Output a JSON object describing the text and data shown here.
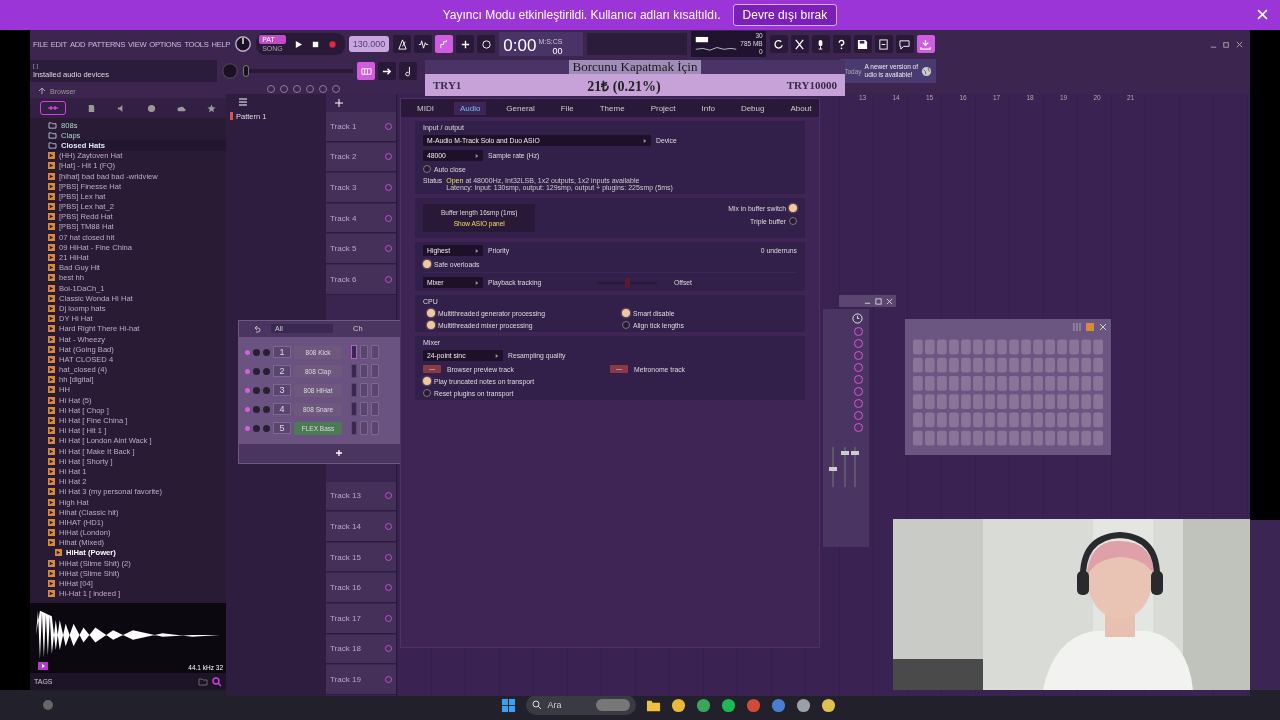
{
  "banner": {
    "message": "Yayıncı Modu etkinleştirildi. Kullanıcı adları kısaltıldı.",
    "button": "Devre dışı bırak"
  },
  "menu": [
    "FILE",
    "EDIT",
    "ADD",
    "PATTERNS",
    "VIEW",
    "OPTIONS",
    "TOOLS",
    "HELP"
  ],
  "transport": {
    "modes": [
      {
        "label": "PAT",
        "selected": true
      },
      {
        "label": "SONG",
        "selected": false
      }
    ],
    "tempo": "130.000",
    "time": "0:00",
    "time_cs": "00",
    "time_unit": "M:S:CS"
  },
  "meters": {
    "cpu": "30",
    "memory": "785 MB",
    "polyphony": "0"
  },
  "master_pitch": {
    "level": 0.0
  },
  "mixer_sends": [
    {
      "on": false
    },
    {
      "on": false
    },
    {
      "on": false
    },
    {
      "on": false
    },
    {
      "on": false
    },
    {
      "on": false
    },
    {
      "on": false
    },
    {
      "on": false
    },
    {
      "on": false
    }
  ],
  "hint_bar": {
    "brackets": "[ ]",
    "text": "Installed audio devices"
  },
  "news": {
    "label": "Today",
    "line1": "A newer version of",
    "line2": "udio is available!"
  },
  "donation": {
    "title": "Borcunu Kapatmak İçin",
    "goal_start": "TRY1",
    "amount": "21₺ (0.21%)",
    "goal_end": "TRY10000"
  },
  "browser": {
    "title": "Browser",
    "folders": [
      {
        "name": "808s",
        "expanded": false
      },
      {
        "name": "Claps",
        "expanded": false
      },
      {
        "name": "Closed Hats",
        "expanded": true,
        "children": [
          {
            "name": "(HH) Zaytoven Hat",
            "selected": false
          },
          {
            "name": "[Hat] - Hit 1 (FQ)",
            "selected": false
          },
          {
            "name": "[hihat] bad bad bad -wrldview",
            "selected": false
          },
          {
            "name": "[PBS] Finesse Hat",
            "selected": false
          },
          {
            "name": "[PBS] Lex hat",
            "selected": false
          },
          {
            "name": "[PBS] Lex hat_2",
            "selected": false
          },
          {
            "name": "[PBS] Redd Hat",
            "selected": false
          },
          {
            "name": "[PBS] TM88 Hat",
            "selected": false
          },
          {
            "name": "07 hat closed hit",
            "selected": false
          },
          {
            "name": "09 HiHat - Fine China",
            "selected": false
          },
          {
            "name": "21 HiHat",
            "selected": false
          },
          {
            "name": "Bad Guy Hit",
            "selected": false
          },
          {
            "name": "best hh",
            "selected": false
          },
          {
            "name": "Boi-1DaCh_1",
            "selected": false
          },
          {
            "name": "Classic Wonda Hi Hat",
            "selected": false
          },
          {
            "name": "Dj loomp hats",
            "selected": false
          },
          {
            "name": "DY Hi Hat",
            "selected": false
          },
          {
            "name": "Hard Right There Hi-hat",
            "selected": false
          },
          {
            "name": "Hat - Wheezy",
            "selected": false
          },
          {
            "name": "Hat (Going Bad)",
            "selected": false
          },
          {
            "name": "HAT CLOSED 4",
            "selected": false
          },
          {
            "name": "hat_closed (4)",
            "selected": false
          },
          {
            "name": "hh [digital]",
            "selected": false
          },
          {
            "name": "HH",
            "selected": false
          },
          {
            "name": "Hi Hat (5)",
            "selected": false
          },
          {
            "name": "Hi Hat [ Chop ]",
            "selected": false
          },
          {
            "name": "Hi Hat [ Fine China ]",
            "selected": false
          },
          {
            "name": "Hi Hat [ Hit 1 ]",
            "selected": false
          },
          {
            "name": "Hi Hat [ London Aint Wack ]",
            "selected": false
          },
          {
            "name": "Hi Hat [ Make It Back ]",
            "selected": false
          },
          {
            "name": "Hi Hat [ Shorty ]",
            "selected": false
          },
          {
            "name": "Hi Hat 1",
            "selected": false
          },
          {
            "name": "Hi Hat 2",
            "selected": false
          },
          {
            "name": "Hi Hat 3 (my personal favorite)",
            "selected": false
          },
          {
            "name": "High Hat",
            "selected": false
          },
          {
            "name": "Hihat (Classic hit)",
            "selected": false
          },
          {
            "name": "HIHAT (HD1)",
            "selected": false
          },
          {
            "name": "HiHat (London)",
            "selected": false
          },
          {
            "name": "Hihat (Mixed)",
            "selected": false
          },
          {
            "name": "HiHat (Power)",
            "selected": true
          },
          {
            "name": "HiHat (Slime Shit) (2)",
            "selected": false
          },
          {
            "name": "HiHat (Slime Shit)",
            "selected": false
          },
          {
            "name": "HiHat [04]",
            "selected": false
          },
          {
            "name": "Hi-Hat 1 [ indeed ]",
            "selected": false
          }
        ]
      }
    ],
    "sample_info": "44.1 kHz 32",
    "tags": "TAGS"
  },
  "playlist": {
    "pattern": "Pattern 1",
    "tracks_top": [
      "Track 1",
      "Track 2",
      "Track 3",
      "Track 4",
      "Track 5",
      "Track 6"
    ],
    "tracks_bottom": [
      "Track 13",
      "Track 14",
      "Track 15",
      "Track 16",
      "Track 17",
      "Track 18",
      "Track 19"
    ],
    "bars": [
      "13",
      "14",
      "15",
      "16",
      "17",
      "18",
      "19",
      "20",
      "21"
    ]
  },
  "channel_rack": {
    "filter": "All",
    "title": "Ch",
    "channels": [
      {
        "number": "1",
        "name": "808 Kick",
        "color": "#6e587e"
      },
      {
        "number": "2",
        "name": "808 Clap",
        "color": "#6e587e"
      },
      {
        "number": "3",
        "name": "808 HiHat",
        "color": "#6e587e"
      },
      {
        "number": "4",
        "name": "808 Snare",
        "color": "#6e587e"
      },
      {
        "number": "5",
        "name": "FLEX Bass",
        "color": "#4c7a55"
      }
    ]
  },
  "settings": {
    "tabs": [
      {
        "label": "MIDI",
        "selected": false
      },
      {
        "label": "Audio",
        "selected": true
      },
      {
        "label": "General",
        "selected": false
      },
      {
        "label": "File",
        "selected": false
      },
      {
        "label": "Theme",
        "selected": false
      },
      {
        "label": "Project",
        "selected": false
      },
      {
        "label": "Info",
        "selected": false
      },
      {
        "label": "Debug",
        "selected": false
      },
      {
        "label": "About",
        "selected": false
      }
    ],
    "io": {
      "heading": "Input / output",
      "device": "M-Audio M-Track Solo and Duo ASIO",
      "device_label": "Device",
      "sample_rate": "48000",
      "sample_rate_label": "Sample rate (Hz)",
      "auto_close": {
        "label": "Auto close",
        "checked": false
      },
      "status_label": "Status",
      "status_state": "Open",
      "status_detail": "at 48000Hz, Int32LSB, 1x2 outputs, 1x2 inputs available",
      "latency": "Latency: input: 130smp, output: 129smp, output + plugins: 225smp (5ms)"
    },
    "buffer": {
      "length": "Buffer length 16smp (1ms)",
      "asio_link": "Show ASIO panel",
      "options": [
        {
          "label": "Mix in buffer switch",
          "checked": true
        },
        {
          "label": "Triple buffer",
          "checked": false
        }
      ]
    },
    "priority": {
      "value": "Highest",
      "label": "Priority",
      "underruns": "0 underruns",
      "safe_overloads": {
        "label": "Safe overloads",
        "checked": true
      }
    },
    "tracking": {
      "value": "Mixer",
      "label": "Playback tracking",
      "offset_label": "Offset",
      "level": 0.5
    },
    "cpu": {
      "heading": "CPU",
      "options": [
        {
          "label": "Multithreaded generator processing",
          "checked": true
        },
        {
          "label": "Multithreaded mixer processing",
          "checked": true
        },
        {
          "label": "Smart disable",
          "checked": true
        },
        {
          "label": "Align tick lengths",
          "checked": false
        }
      ]
    },
    "mixer": {
      "heading": "Mixer",
      "resampling": "24-point sinc",
      "resampling_label": "Resampling quality",
      "tracks": [
        {
          "value": "---",
          "label": "Browser preview track"
        },
        {
          "value": "---",
          "label": "Metronome track"
        }
      ],
      "options": [
        {
          "label": "Play truncated notes on transport",
          "checked": true
        },
        {
          "label": "Reset plugins on transport",
          "checked": false
        }
      ]
    }
  },
  "taskbar": {
    "search": "Ara"
  }
}
